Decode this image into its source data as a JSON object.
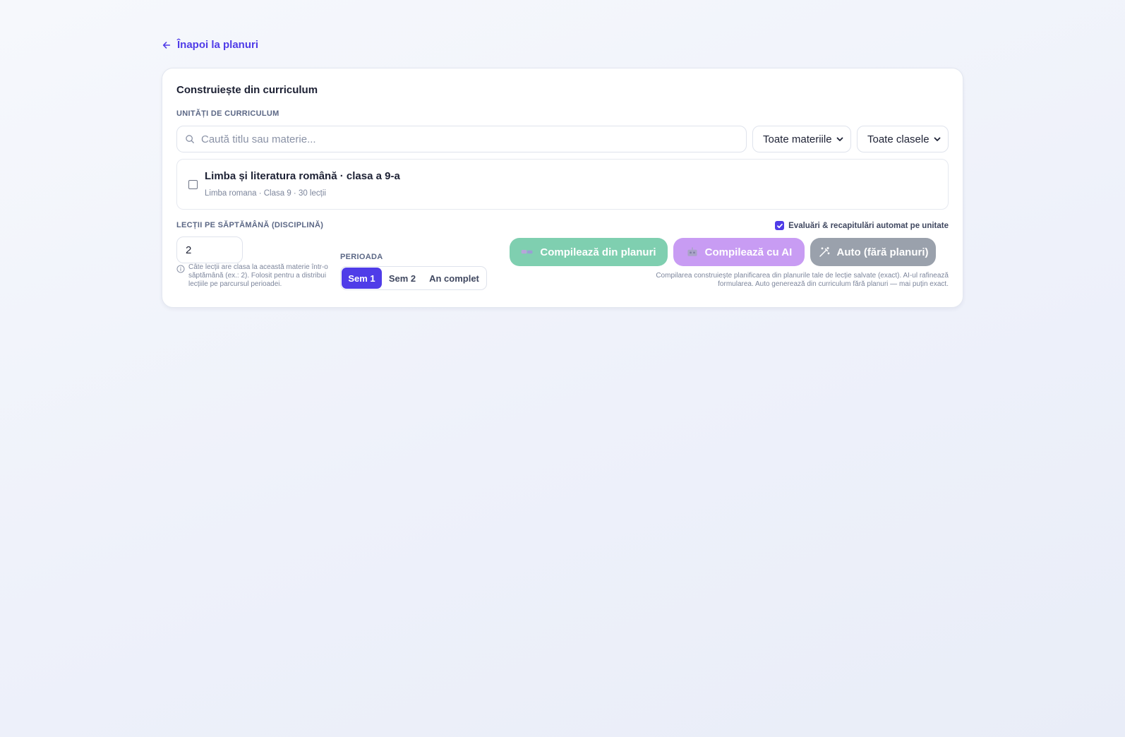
{
  "nav": {
    "back_label": "Înapoi la planuri"
  },
  "card": {
    "title": "Construiește din curriculum",
    "units_label": "UNITĂȚI DE CURRICULUM",
    "search": {
      "placeholder": "Caută titlu sau materie...",
      "value": ""
    },
    "subject_filter": {
      "selected": "Toate materiile"
    },
    "class_filter": {
      "selected": "Toate clasele"
    },
    "units": [
      {
        "title": "Limba și literatura română · clasa a 9-a",
        "meta": "Limba romana · Clasa 9 · 30 lecții",
        "checked": false
      }
    ],
    "lessons": {
      "label": "LECȚII PE SĂPTĂMÂNĂ (DISCIPLINĂ)",
      "value": "2",
      "hint": "Câte lecții are clasa la această materie într-o săptămână (ex.: 2). Folosit pentru a distribui lecțiile pe parcursul perioadei."
    },
    "period": {
      "label": "PERIOADA",
      "options": [
        "Sem 1",
        "Sem 2",
        "An complet"
      ],
      "selected": "Sem 1"
    },
    "auto_eval": {
      "label": "Evaluări & recapitulări automat pe unitate",
      "checked": true
    },
    "actions": {
      "compile_plans": "Compilează din planuri",
      "compile_ai": "Compilează cu AI",
      "auto": "Auto (fără planuri)"
    },
    "footnote": "Compilarea construiește planificarea din planurile tale de lecție salvate (exact). AI-ul rafinează formularea. Auto generează din curriculum fără planuri — mai puțin exact."
  },
  "colors": {
    "accent": "#4f3ce8",
    "btn_plans": "#7fcfb0",
    "btn_ai": "#c89cf3",
    "btn_auto": "#9aa1ac"
  }
}
